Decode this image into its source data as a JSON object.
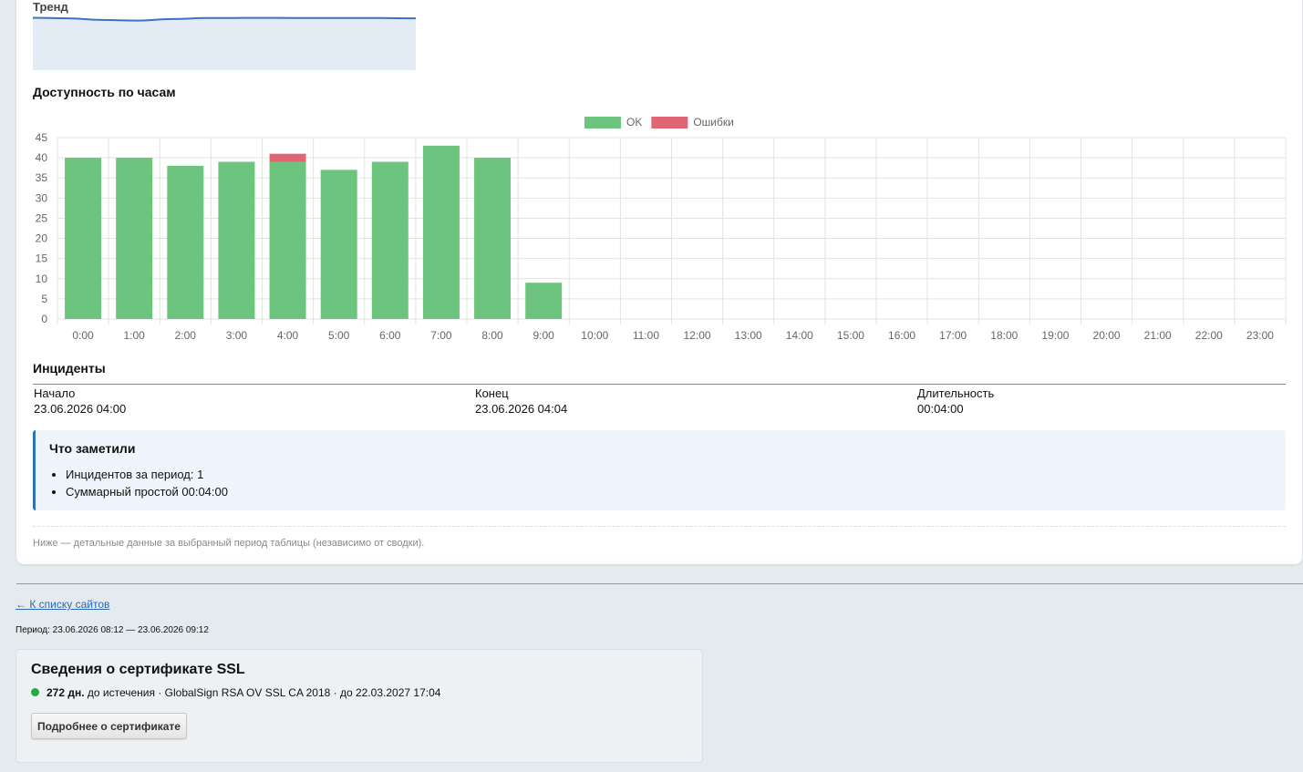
{
  "trend": {
    "title": "Тренд",
    "values": [
      0.82,
      0.78,
      0.65,
      0.6,
      0.72,
      0.8,
      0.81,
      0.81,
      0.8,
      0.8,
      0.8,
      0.78
    ]
  },
  "availability": {
    "title": "Доступность по часам"
  },
  "chart_data": {
    "type": "bar",
    "stacked": true,
    "legend_position": "top",
    "grid": true,
    "ylim": [
      0,
      45
    ],
    "yticks": [
      0,
      5,
      10,
      15,
      20,
      25,
      30,
      35,
      40,
      45
    ],
    "categories": [
      "0:00",
      "1:00",
      "2:00",
      "3:00",
      "4:00",
      "5:00",
      "6:00",
      "7:00",
      "8:00",
      "9:00",
      "10:00",
      "11:00",
      "12:00",
      "13:00",
      "14:00",
      "15:00",
      "16:00",
      "17:00",
      "18:00",
      "19:00",
      "20:00",
      "21:00",
      "22:00",
      "23:00"
    ],
    "series": [
      {
        "name": "OK",
        "color": "#6cc47e",
        "values": [
          40,
          40,
          38,
          39,
          39,
          37,
          39,
          43,
          40,
          9,
          0,
          0,
          0,
          0,
          0,
          0,
          0,
          0,
          0,
          0,
          0,
          0,
          0,
          0
        ]
      },
      {
        "name": "Ошибки",
        "color": "#e06673",
        "values": [
          0,
          0,
          0,
          0,
          2,
          0,
          0,
          0,
          0,
          0,
          0,
          0,
          0,
          0,
          0,
          0,
          0,
          0,
          0,
          0,
          0,
          0,
          0,
          0
        ]
      }
    ]
  },
  "incidents": {
    "title": "Инциденты",
    "columns": [
      "Начало",
      "Конец",
      "Длительность"
    ],
    "rows": [
      [
        "23.06.2026 04:00",
        "23.06.2026 04:04",
        "00:04:00"
      ]
    ]
  },
  "notes": {
    "title": "Что заметили",
    "items": [
      "Инцидентов за период: 1",
      "Суммарный простой 00:04:00"
    ]
  },
  "footnote": "Ниже — детальные данные за выбранный период таблицы (независимо от сводки).",
  "back_link": "← К списку сайтов",
  "period": "Период: 23.06.2026 08:12 — 23.06.2026 09:12",
  "ssl": {
    "title": "Сведения о сертификате SSL",
    "status_color": "#28a745",
    "days": "272 дн.",
    "rest": " до истечения · GlobalSign RSA OV SSL CA 2018 · до 22.03.2027 17:04",
    "button": "Подробнее о сертификате"
  }
}
